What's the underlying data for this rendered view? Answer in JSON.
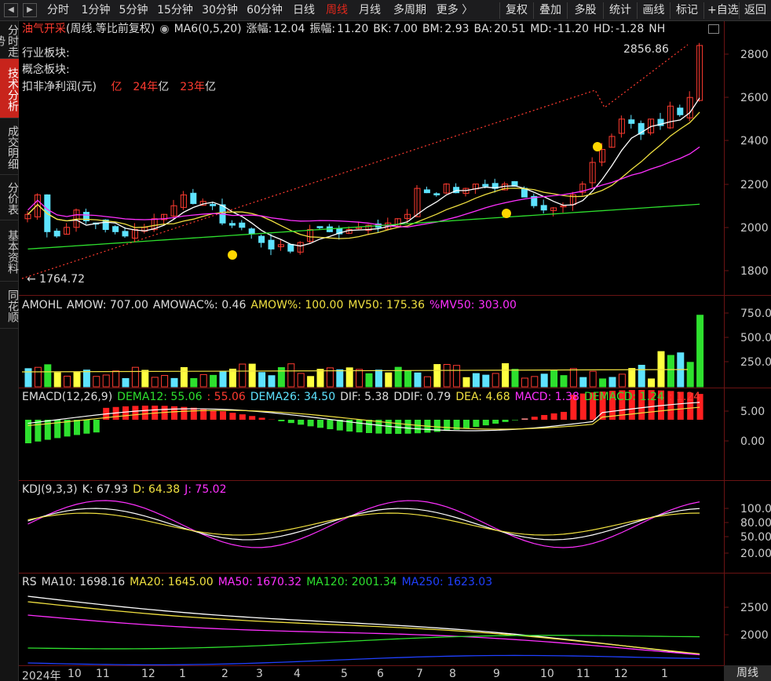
{
  "toolbar": {
    "periods": [
      "分时",
      "1分钟",
      "5分钟",
      "15分钟",
      "30分钟",
      "60分钟",
      "日线",
      "周线",
      "月线",
      "多周期",
      "更多 〉"
    ],
    "active_period": "周线",
    "actions": [
      "复权",
      "叠加",
      "多股",
      "统计",
      "画线",
      "标记",
      "+自选",
      "返回"
    ]
  },
  "sidebar": {
    "tabs": [
      "分时走势",
      "技术分析",
      "成交明细",
      "分价表",
      "基本资料",
      "同花顺"
    ],
    "active": "技术分析"
  },
  "main": {
    "stock_name": "油气开采",
    "mode": "(周线.等比前复权)",
    "ma_label": "MA6(0,5,20)",
    "stats": [
      {
        "label": "涨幅:",
        "value": "12.04"
      },
      {
        "label": "振幅:",
        "value": "11.20"
      },
      {
        "label": "BK:",
        "value": "7.00"
      },
      {
        "label": "BM:",
        "value": "2.93"
      },
      {
        "label": "BA:",
        "value": "20.51"
      },
      {
        "label": "MD:",
        "value": "-11.20"
      },
      {
        "label": "HD:",
        "value": "-1.28"
      },
      {
        "label": "NH",
        "value": ""
      }
    ],
    "info_lines": [
      "行业板块:",
      "概念板块:"
    ],
    "profit_label": "扣非净利润(元)",
    "profit_items": [
      {
        "year": "亿",
        "unit": ""
      },
      {
        "year": "24年",
        "unit": "亿"
      },
      {
        "year": "23年",
        "unit": "亿"
      }
    ],
    "high_label": "2856.86",
    "low_label": "1764.72",
    "y_ticks": [
      "2800",
      "2600",
      "2400",
      "2200",
      "2000",
      "1800"
    ]
  },
  "amo": {
    "title": "AMOHL",
    "items": [
      {
        "label": "AMOW: 707.00",
        "color": "#dddddd"
      },
      {
        "label": "AMOWAC%: 0.46",
        "color": "#dddddd"
      },
      {
        "label": "AMOW%: 100.00",
        "color": "#f0e040"
      },
      {
        "label": "MV50: 175.36",
        "color": "#f0e040"
      },
      {
        "label": "%MV50: 303.00",
        "color": "#ff30ff"
      }
    ],
    "y_ticks": [
      "750.0",
      "500.0",
      "250.0"
    ]
  },
  "macd": {
    "title": "EMACD(12,26,9)",
    "items": [
      {
        "label": "DEMA12: 55.06",
        "color": "#2ee02e"
      },
      {
        "label": ": 55.06",
        "color": "#ff3b30"
      },
      {
        "label": "DEMA26: 34.50",
        "color": "#5ee3ff"
      },
      {
        "label": "DIF: 5.38",
        "color": "#dddddd"
      },
      {
        "label": "DDIF: 0.79",
        "color": "#dddddd"
      },
      {
        "label": "DEA: 4.68",
        "color": "#f0e040"
      },
      {
        "label": "MACD: 1.38",
        "color": "#ff30ff"
      },
      {
        "label": "DEMACD: 1.24",
        "color": "#2ee02e"
      },
      {
        "label": ": 1.24",
        "color": "#ff3b30"
      }
    ],
    "y_ticks": [
      "5.00",
      "0.00"
    ]
  },
  "kdj": {
    "title": "KDJ(9,3,3)",
    "items": [
      {
        "label": "K: 67.93",
        "color": "#dddddd"
      },
      {
        "label": "D: 64.38",
        "color": "#f0e040"
      },
      {
        "label": "J: 75.02",
        "color": "#ff30ff"
      }
    ],
    "y_ticks": [
      "100.00",
      "80.00",
      "50.00",
      "20.00"
    ]
  },
  "rs": {
    "title": "RS",
    "items": [
      {
        "label": "MA10: 1698.16",
        "color": "#dddddd"
      },
      {
        "label": "MA20: 1645.00",
        "color": "#f0e040"
      },
      {
        "label": "MA50: 1670.32",
        "color": "#ff30ff"
      },
      {
        "label": "MA120: 2001.34",
        "color": "#2ee02e"
      },
      {
        "label": "MA250: 1623.03",
        "color": "#2040ff"
      }
    ],
    "y_ticks": [
      "2500",
      "2000"
    ]
  },
  "x_axis": {
    "labels": [
      "2024年",
      "10",
      "11",
      "12",
      "1",
      "2",
      "3",
      "4",
      "5",
      "6",
      "7",
      "8",
      "9",
      "10",
      "11",
      "12",
      "1"
    ],
    "period": "周线"
  },
  "colors": {
    "up": "#ff3b30",
    "down": "#5ee3ff",
    "bg": "#000000",
    "accent": "#c8241c"
  }
}
